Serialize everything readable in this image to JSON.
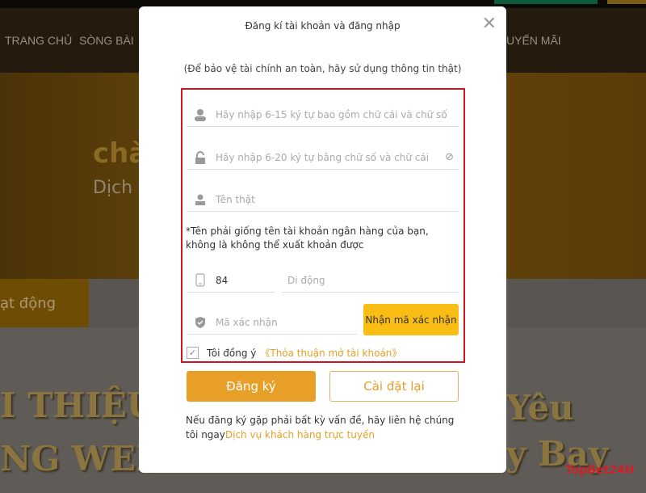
{
  "background": {
    "nav": [
      "TRANG CHỦ",
      "SÒNG BÀI",
      "UYẾN MÃI"
    ],
    "hero_title": "chà",
    "hero_sub": "Dịch v",
    "band_text": "ạt động",
    "left_big": [
      "I THIỆU",
      "NG WEB"
    ],
    "right_big": [
      "Yêu",
      "y Bay"
    ],
    "watermark": "TopBet24H"
  },
  "modal": {
    "title": "Đăng kí tài khoản và đăng nhập",
    "subtitle": "(Để bảo vệ tài chính an toàn, hãy sử dụng thông tin thật)",
    "username_placeholder": "Hãy nhập 6-15 ký tự bao gồm chữ cái và chữ số",
    "password_placeholder": "Hãy nhập 6-20 ký tự bằng chữ số và chữ cái",
    "realname_placeholder": "Tên thật",
    "note": "*Tên phải giống tên tài khoản ngân hàng của bạn, không là không thể xuất khoản được",
    "country_code": "84",
    "phone_placeholder": "Di động",
    "code_placeholder": "Mã xác nhận",
    "get_code": "Nhận mã xác nhận",
    "agree_label": "Tôi đồng ý",
    "agree_link": "《Thỏa thuận mở tài khoản》",
    "agree_checked": true,
    "register": "Đăng ký",
    "reset": "Cài đặt lại",
    "help_text": "Nếu đăng ký gặp phải bất kỳ vấn đề, hãy liên hệ chúng tôi ngay",
    "help_link": "Dịch vụ khách hàng trực tuyến",
    "highlight_color": "#d6121f",
    "accent": "#e79f28"
  }
}
